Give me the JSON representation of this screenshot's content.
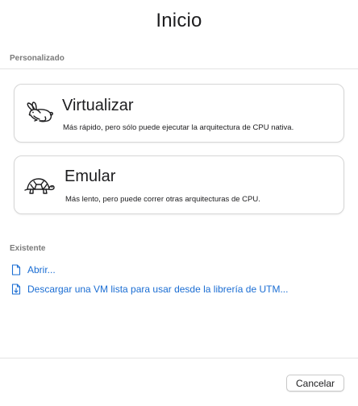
{
  "window": {
    "title": "Inicio"
  },
  "custom_section": {
    "label": "Personalizado",
    "options": [
      {
        "title": "Virtualizar",
        "description": "Más rápido, pero sólo puede ejecutar la arquitectura de CPU nativa.",
        "icon": "hare-icon"
      },
      {
        "title": "Emular",
        "description": "Más lento, pero puede correr otras arquitecturas de CPU.",
        "icon": "tortoise-icon"
      }
    ]
  },
  "existing_section": {
    "label": "Existente",
    "links": [
      {
        "label": "Abrir...",
        "icon": "document-icon"
      },
      {
        "label": "Descargar una VM lista para usar desde la librería de UTM...",
        "icon": "document-download-icon"
      }
    ]
  },
  "footer": {
    "cancel_label": "Cancelar"
  },
  "colors": {
    "link": "#1a6dd3",
    "section_label": "#7a7a7a",
    "card_border": "#d6d6d6"
  }
}
